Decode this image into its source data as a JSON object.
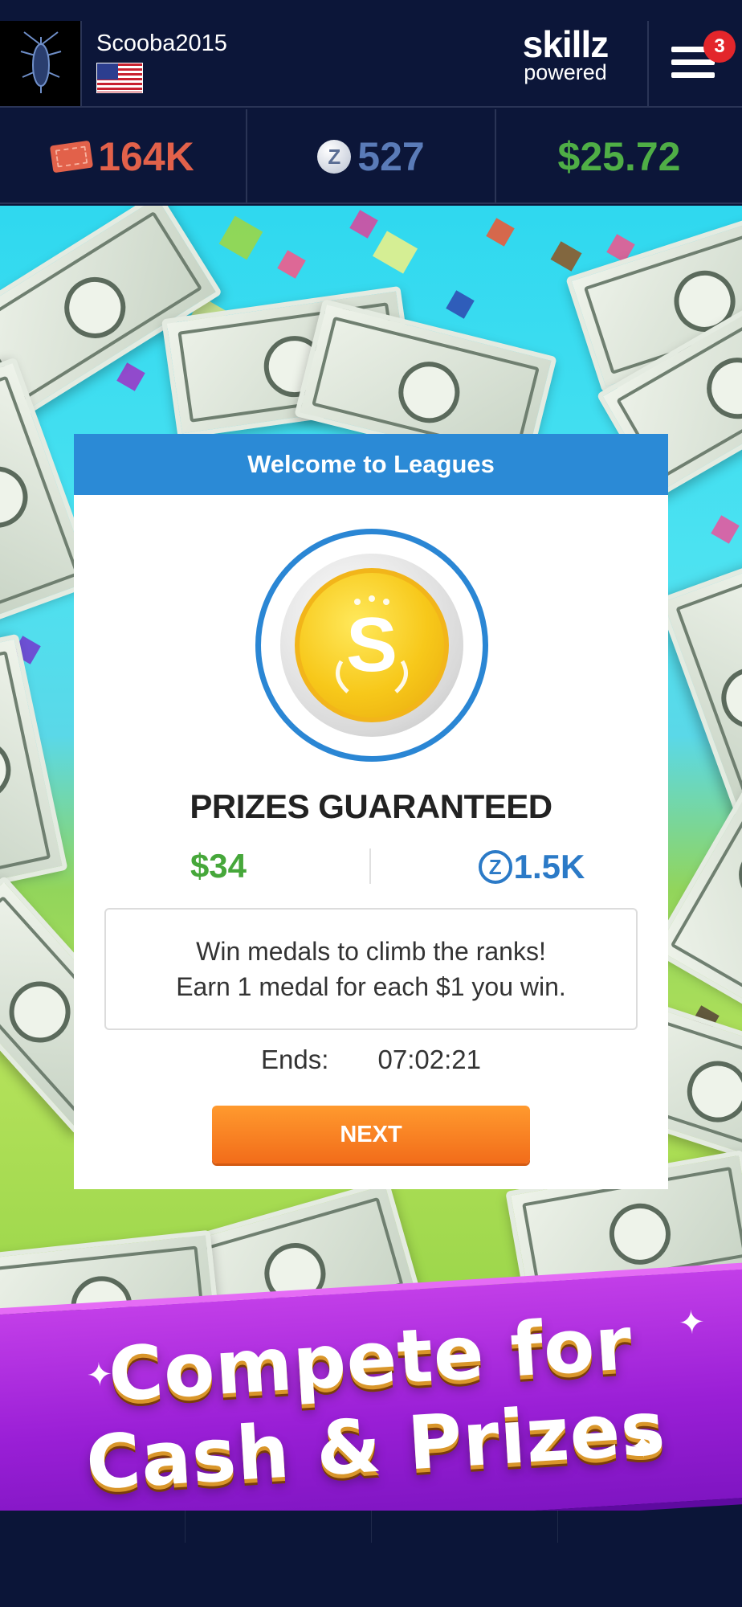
{
  "header": {
    "username": "Scooba2015",
    "logo_line1": "skillz",
    "logo_line2": "powered",
    "notification_count": "3"
  },
  "balances": {
    "tickets": "164K",
    "z_coins": "527",
    "cash": "$25.72"
  },
  "modal": {
    "title": "Welcome to Leagues",
    "medal_letter": "S",
    "prizes_title": "PRIZES GUARANTEED",
    "prize_cash": "$34",
    "prize_z": "1.5K",
    "z_symbol": "Z",
    "info_line1": "Win medals to climb the ranks!",
    "info_line2": "Earn 1 medal for each $1 you win.",
    "ends_label": "Ends:",
    "ends_time": "07:02:21",
    "next_label": "NEXT"
  },
  "banner": {
    "line1": "Compete for",
    "line2": "Cash & Prizes"
  },
  "colors": {
    "header_bg": "#0c1639",
    "ticket": "#e2614a",
    "z_coin": "#5a7bb8",
    "cash": "#4fae46",
    "modal_header": "#2b8ad6",
    "next_button": "#f27a1f",
    "banner": "#9a1fd6"
  },
  "icons": [
    "avatar-image",
    "us-flag-icon",
    "hamburger-menu-icon",
    "ticket-icon",
    "z-coin-icon",
    "gold-medal-icon"
  ]
}
